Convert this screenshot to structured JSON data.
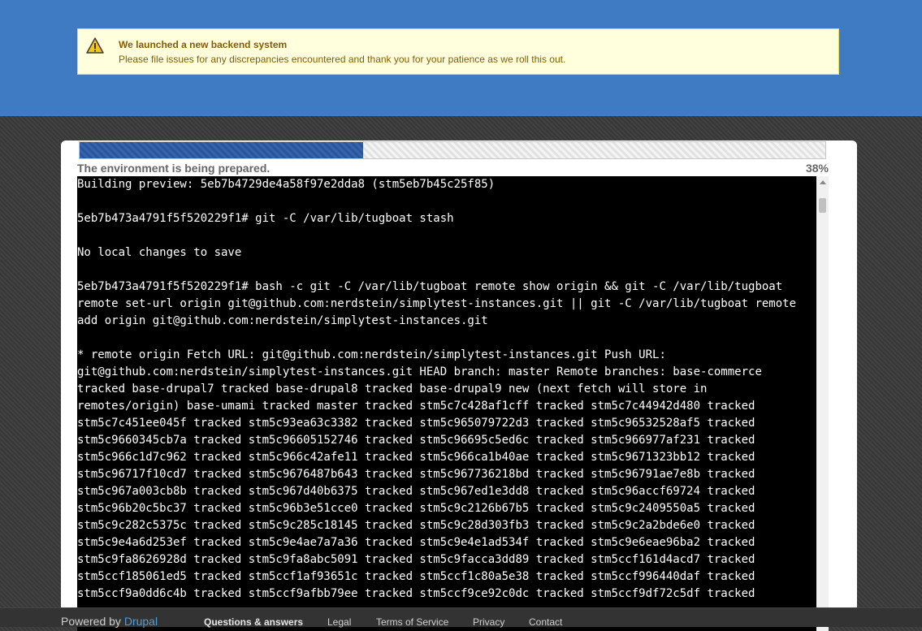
{
  "notice": {
    "title": "We launched a new backend system",
    "body": "Please file issues for any discrepancies encountered and thank you for your patience as we roll this out.",
    "icon": "warning-icon"
  },
  "progress": {
    "status": "The environment is being prepared.",
    "percent_label": "38%",
    "value": 0.38
  },
  "terminal": {
    "lines": [
      "Building preview: 5eb7b4729de4a58f97e2dda8 (stm5eb7b45c25f85)",
      "",
      "5eb7b473a4791f5f520229f1# git -C /var/lib/tugboat stash",
      "",
      "No local changes to save",
      "",
      "5eb7b473a4791f5f520229f1# bash -c git -C /var/lib/tugboat remote show origin && git -C /var/lib/tugboat",
      "remote set-url origin git@github.com:nerdstein/simplytest-instances.git || git -C /var/lib/tugboat remote",
      "add origin git@github.com:nerdstein/simplytest-instances.git",
      "",
      "* remote origin Fetch URL: git@github.com:nerdstein/simplytest-instances.git Push URL:",
      "git@github.com:nerdstein/simplytest-instances.git HEAD branch: master Remote branches: base-commerce",
      "tracked base-drupal7 tracked base-drupal8 tracked base-drupal9 new (next fetch will store in",
      "remotes/origin) base-umami tracked master tracked stm5c7c428af1cff tracked stm5c7c44942d480 tracked",
      "stm5c7c451ee045f tracked stm5c93ea63c3382 tracked stm5c965079722d3 tracked stm5c96532528af5 tracked",
      "stm5c9660345cb7a tracked stm5c96605152746 tracked stm5c96695c5ed6c tracked stm5c966977af231 tracked",
      "stm5c966c1d7c962 tracked stm5c966c42afe11 tracked stm5c966ca1b40ae tracked stm5c9671323bb12 tracked",
      "stm5c96717f10cd7 tracked stm5c9676487b643 tracked stm5c967736218bd tracked stm5c96791ae7e8b tracked",
      "stm5c967a003cb8b tracked stm5c967d40b6375 tracked stm5c967ed1e3dd8 tracked stm5c96accf69724 tracked",
      "stm5c96b20c5bc37 tracked stm5c96b3e51cce0 tracked stm5c9c2126b67b5 tracked stm5c9c2409550a5 tracked",
      "stm5c9c282c5375c tracked stm5c9c285c18145 tracked stm5c9c28d303fb3 tracked stm5c9c2a2bde6e0 tracked",
      "stm5c9e4a6d253ef tracked stm5c9e4ae7a7a36 tracked stm5c9e4e1ad534f tracked stm5c9e6eae96ba2 tracked",
      "stm5c9fa8626928d tracked stm5c9fa8abc5091 tracked stm5c9facca3dd89 tracked stm5ccf161d4acd7 tracked",
      "stm5ccf185061ed5 tracked stm5ccf1af93651c tracked stm5ccf1c80a5e38 tracked stm5ccf996440daf tracked",
      "stm5ccf9a0dd6c4b tracked stm5ccf9afbb79ee tracked stm5ccf9ce92c0dc tracked stm5ccf9df72c5df tracked"
    ]
  },
  "footer": {
    "powered_prefix": "Powered by ",
    "powered_link": "Drupal",
    "links": [
      "Questions & answers",
      "Legal",
      "Terms of Service",
      "Privacy",
      "Contact"
    ]
  }
}
